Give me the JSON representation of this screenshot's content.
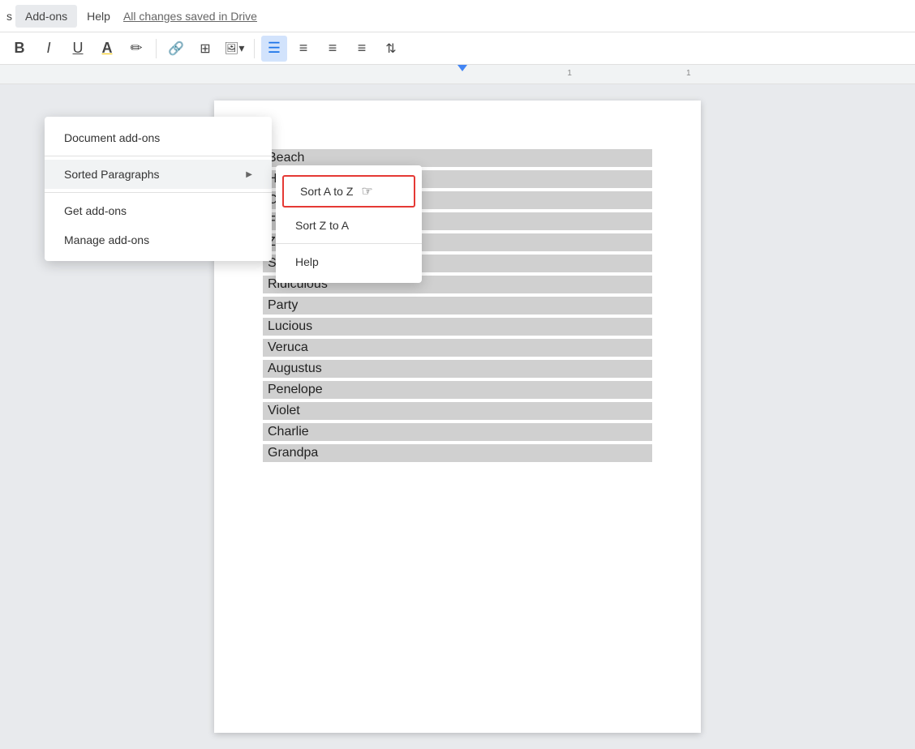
{
  "menu_bar": {
    "items": [
      {
        "label": "Add-ons",
        "id": "addons",
        "active": true
      },
      {
        "label": "Help",
        "id": "help",
        "active": false
      }
    ],
    "save_status": "All changes saved in Drive"
  },
  "toolbar": {
    "buttons": [
      {
        "id": "bold",
        "label": "B",
        "style": "bold",
        "active": false
      },
      {
        "id": "italic",
        "label": "I",
        "style": "italic",
        "active": false
      },
      {
        "id": "underline",
        "label": "U",
        "style": "underline",
        "active": false
      },
      {
        "id": "font-color",
        "label": "A",
        "active": false
      },
      {
        "id": "highlight",
        "label": "✏",
        "active": false
      },
      {
        "id": "link",
        "label": "🔗",
        "active": false
      },
      {
        "id": "insert-image",
        "label": "+⬜",
        "active": false
      },
      {
        "id": "align-left",
        "label": "≡",
        "active": true
      },
      {
        "id": "align-center",
        "label": "≡",
        "active": false
      },
      {
        "id": "align-right",
        "label": "≡",
        "active": false
      },
      {
        "id": "align-justify",
        "label": "≡",
        "active": false
      },
      {
        "id": "line-spacing",
        "label": "↕",
        "active": false
      }
    ]
  },
  "addons_menu": {
    "title": "Add-ons",
    "items": [
      {
        "id": "document-addons",
        "label": "Document add-ons",
        "has_arrow": false
      },
      {
        "id": "sorted-paragraphs",
        "label": "Sorted Paragraphs",
        "has_arrow": true
      },
      {
        "id": "get-addons",
        "label": "Get add-ons",
        "has_arrow": false
      },
      {
        "id": "manage-addons",
        "label": "Manage add-ons",
        "has_arrow": false
      }
    ]
  },
  "sorted_paragraphs_submenu": {
    "items": [
      {
        "id": "sort-a-to-z",
        "label": "Sort A to Z",
        "highlighted": true
      },
      {
        "id": "sort-z-to-a",
        "label": "Sort Z to A"
      },
      {
        "id": "help",
        "label": "Help"
      }
    ]
  },
  "document": {
    "words": [
      "Beach",
      "House",
      "Church",
      "Firehouse",
      "Zebra",
      "Sandals",
      "Ridiculous",
      "Party",
      "Lucious",
      "Veruca",
      "Augustus",
      "Penelope",
      "Violet",
      "Charlie",
      "Grandpa"
    ]
  }
}
